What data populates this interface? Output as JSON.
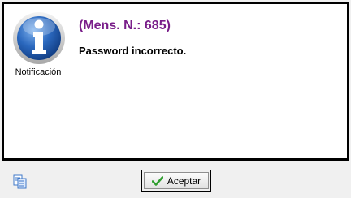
{
  "dialog": {
    "icon": "information-icon",
    "icon_caption": "Notificación",
    "title": "(Mens. N.: 685)",
    "message": "Password incorrecto."
  },
  "footer": {
    "copy_icon": "copy-icon",
    "accept_label": "Aceptar",
    "accept_icon": "checkmark-icon"
  },
  "colors": {
    "title": "#7a1f8a",
    "icon_blue": "#1f5fb8",
    "check_green": "#2f9e2f"
  }
}
